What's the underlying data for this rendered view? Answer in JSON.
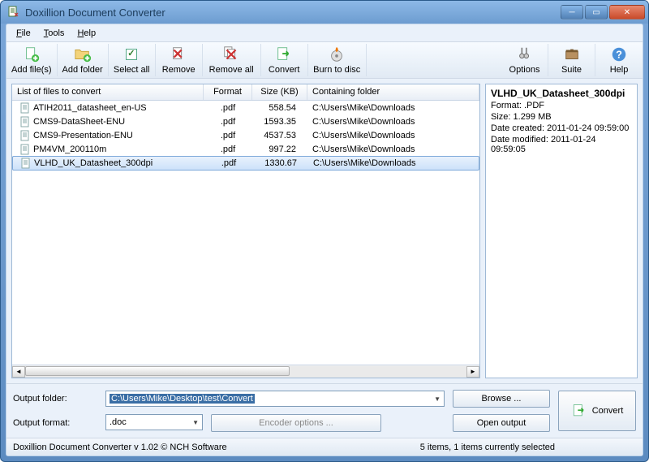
{
  "window": {
    "title": "Doxillion Document Converter"
  },
  "menu": {
    "file": "File",
    "tools": "Tools",
    "help": "Help"
  },
  "toolbar": {
    "addFiles": "Add file(s)",
    "addFolder": "Add folder",
    "selectAll": "Select all",
    "remove": "Remove",
    "removeAll": "Remove all",
    "convert": "Convert",
    "burn": "Burn to disc",
    "options": "Options",
    "suite": "Suite",
    "help": "Help"
  },
  "columns": {
    "name": "List of files to convert",
    "format": "Format",
    "size": "Size (KB)",
    "folder": "Containing folder"
  },
  "files": [
    {
      "name": "ATIH2011_datasheet_en-US",
      "format": ".pdf",
      "size": "558.54",
      "folder": "C:\\Users\\Mike\\Downloads"
    },
    {
      "name": "CMS9-DataSheet-ENU",
      "format": ".pdf",
      "size": "1593.35",
      "folder": "C:\\Users\\Mike\\Downloads"
    },
    {
      "name": "CMS9-Presentation-ENU",
      "format": ".pdf",
      "size": "4537.53",
      "folder": "C:\\Users\\Mike\\Downloads"
    },
    {
      "name": "PM4VM_200110m",
      "format": ".pdf",
      "size": "997.22",
      "folder": "C:\\Users\\Mike\\Downloads"
    },
    {
      "name": "VLHD_UK_Datasheet_300dpi",
      "format": ".pdf",
      "size": "1330.67",
      "folder": "C:\\Users\\Mike\\Downloads"
    }
  ],
  "details": {
    "title": "VLHD_UK_Datasheet_300dpi",
    "formatLabel": "Format: ",
    "format": ".PDF",
    "sizeLabel": "Size: ",
    "size": "1.299 MB",
    "createdLabel": "Date created: ",
    "created": "2011-01-24 09:59:00",
    "modifiedLabel": "Date modified: ",
    "modified": "2011-01-24 09:59:05"
  },
  "output": {
    "folderLabel": "Output folder:",
    "folderValue": "C:\\Users\\Mike\\Desktop\\test\\Convert",
    "formatLabel": "Output format:",
    "formatValue": ".doc",
    "encoderPlaceholder": "Encoder options ...",
    "browse": "Browse ...",
    "open": "Open output",
    "convert": "Convert"
  },
  "status": {
    "left": "Doxillion Document Converter v 1.02 © NCH Software",
    "right": "5 items, 1 items currently selected"
  }
}
